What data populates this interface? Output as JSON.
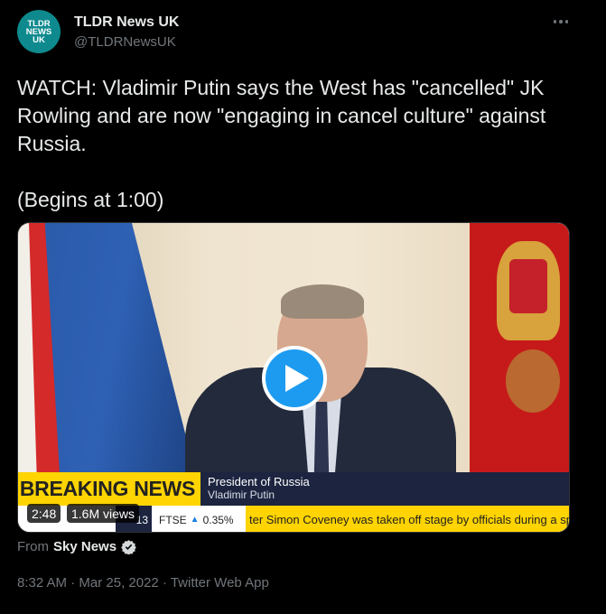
{
  "author": {
    "avatar_lines": [
      "TLDR",
      "NEWS",
      "UK"
    ],
    "name": "TLDR News UK",
    "handle": "@TLDRNewsUK"
  },
  "tweet": {
    "text": "WATCH: Vladimir Putin says the West has \"cancelled\" JK Rowling and are now \"engaging in cancel culture\" against Russia.\n\n(Begins at 1:00)"
  },
  "video": {
    "banner": "BREAKING NEWS",
    "caption_title": "President of Russia",
    "caption_name": "Vladimir Putin",
    "clock": "13",
    "ticker_index": "FTSE",
    "ticker_value": "0.35%",
    "ticker_text": "ter Simon Coveney was taken off stage by officials during a speech in",
    "duration": "2:48",
    "views": "1.6M views"
  },
  "source": {
    "prefix": "From",
    "name": "Sky News"
  },
  "meta": {
    "time": "8:32 AM",
    "date": "Mar 25, 2022",
    "client": "Twitter Web App",
    "sep": " · "
  },
  "colors": {
    "accent": "#1d9bf0",
    "breaking": "#ffd400",
    "caption_bg": "#1c2440",
    "avatar_bg": "#0e8a8e"
  }
}
